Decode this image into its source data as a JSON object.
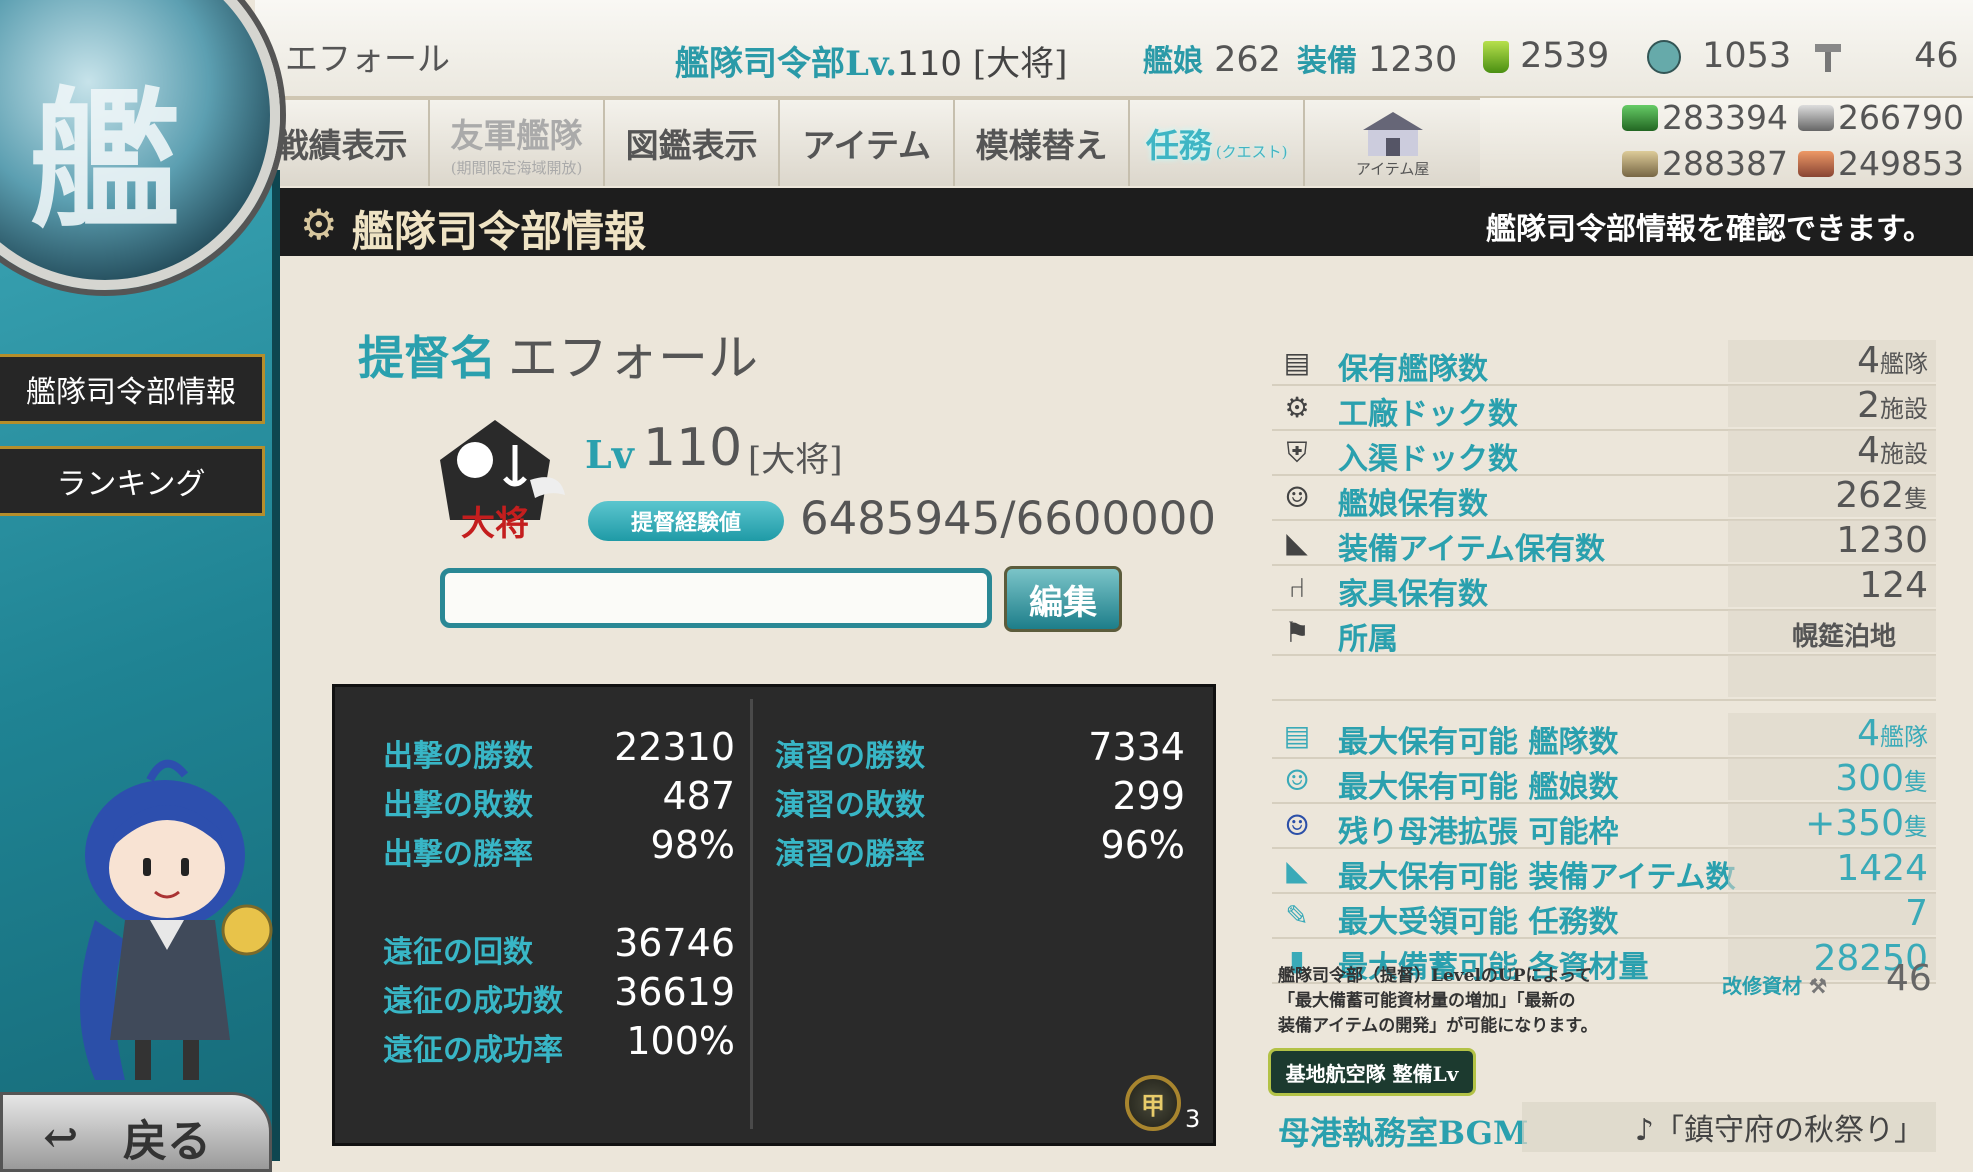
{
  "topbar": {
    "player_name": "エフォール",
    "hq_label": "艦隊司令部Lv.",
    "hq_level": "110",
    "hq_rank": "[大将]",
    "ships_label": "艦娘",
    "ships_count": "262",
    "equip_label": "装備",
    "equip_count": "1230",
    "buckets": "2539",
    "dev_material": "1053",
    "screws": "46"
  },
  "nav": {
    "items": [
      {
        "label": "戦績表示"
      },
      {
        "label": "友軍艦隊",
        "sub": "(期間限定海域開放)"
      },
      {
        "label": "図鑑表示"
      },
      {
        "label": "アイテム"
      },
      {
        "label": "模様替え"
      },
      {
        "label": "任務",
        "sub": "(クエスト)"
      },
      {
        "label": "アイテム屋"
      }
    ]
  },
  "resources": {
    "fuel": "283394",
    "ammo": "266790",
    "steel": "288387",
    "bauxite": "249853"
  },
  "titlebar": {
    "title": "艦隊司令部情報",
    "description": "艦隊司令部情報を確認できます。"
  },
  "sidebar": {
    "items": [
      {
        "label": "艦隊司令部情報"
      },
      {
        "label": "ランキング"
      }
    ],
    "back_label": "戻る"
  },
  "profile": {
    "admiral_label": "提督名",
    "admiral_name": "エフォール",
    "lv_label": "Lv",
    "lv_value": "110",
    "rank": "[大将]",
    "rank_emblem_text": "大将",
    "exp_label": "提督経験値",
    "exp_value": "6485945/6600000",
    "comment_value": "",
    "edit_label": "編集"
  },
  "battle_stats": {
    "left": [
      {
        "label": "出撃の勝数",
        "value": "22310"
      },
      {
        "label": "出撃の敗数",
        "value": "487"
      },
      {
        "label": "出撃の勝率",
        "value": "98%"
      },
      {
        "label": "遠征の回数",
        "value": "36746"
      },
      {
        "label": "遠征の成功数",
        "value": "36619"
      },
      {
        "label": "遠征の成功率",
        "value": "100%"
      }
    ],
    "right": [
      {
        "label": "演習の勝数",
        "value": "7334"
      },
      {
        "label": "演習の敗数",
        "value": "299"
      },
      {
        "label": "演習の勝率",
        "value": "96%"
      }
    ],
    "medal_label": "甲",
    "medal_count": "3"
  },
  "info_table": {
    "rows": [
      {
        "icon": "fleet-icon",
        "label": "保有艦隊数",
        "value": "4",
        "unit": "艦隊"
      },
      {
        "icon": "gear-icon",
        "label": "工廠ドック数",
        "value": "2",
        "unit": "施設"
      },
      {
        "icon": "repair-shield-icon",
        "label": "入渠ドック数",
        "value": "4",
        "unit": "施設"
      },
      {
        "icon": "shipgirl-icon",
        "label": "艦娘保有数",
        "value": "262",
        "unit": "隻"
      },
      {
        "icon": "equipment-icon",
        "label": "装備アイテム保有数",
        "value": "1230",
        "unit": ""
      },
      {
        "icon": "furniture-icon",
        "label": "家具保有数",
        "value": "124",
        "unit": ""
      },
      {
        "icon": "affiliation-icon",
        "label": "所属",
        "value": "幌筵泊地",
        "unit": ""
      }
    ],
    "max_rows": [
      {
        "icon": "fleet-icon",
        "label": "最大保有可能 艦隊数",
        "value": "4",
        "unit": "艦隊"
      },
      {
        "icon": "shipgirl-icon",
        "label": "最大保有可能 艦娘数",
        "value": "300",
        "unit": "隻"
      },
      {
        "icon": "shipgirl-icon",
        "label": "残り母港拡張 可能枠",
        "value": "+350",
        "unit": "隻"
      },
      {
        "icon": "equipment-icon",
        "label": "最大保有可能 装備アイテム数",
        "value": "1424",
        "unit": ""
      },
      {
        "icon": "quill-icon",
        "label": "最大受領可能 任務数",
        "value": "7",
        "unit": ""
      },
      {
        "icon": "book-icon",
        "label": "最大備蓄可能 各資材量",
        "value": "28250",
        "unit": ""
      }
    ]
  },
  "note": {
    "line1": "艦隊司令部（提督）LevelのUPによって",
    "line2": "「最大備蓄可能資材量の増加」「最新の",
    "line3": "装備アイテムの開発」が可能になります。"
  },
  "improvement": {
    "label": "改修資材",
    "value": "46"
  },
  "base_air": {
    "label": "基地航空隊 整備Lv"
  },
  "bgm": {
    "label": "母港執務室BGM",
    "value": "♪「鎮守府の秋祭り」"
  },
  "colors": {
    "accent_teal": "#2aa0ae",
    "panel_dark": "#2a2a2a",
    "background": "#ece6da"
  }
}
